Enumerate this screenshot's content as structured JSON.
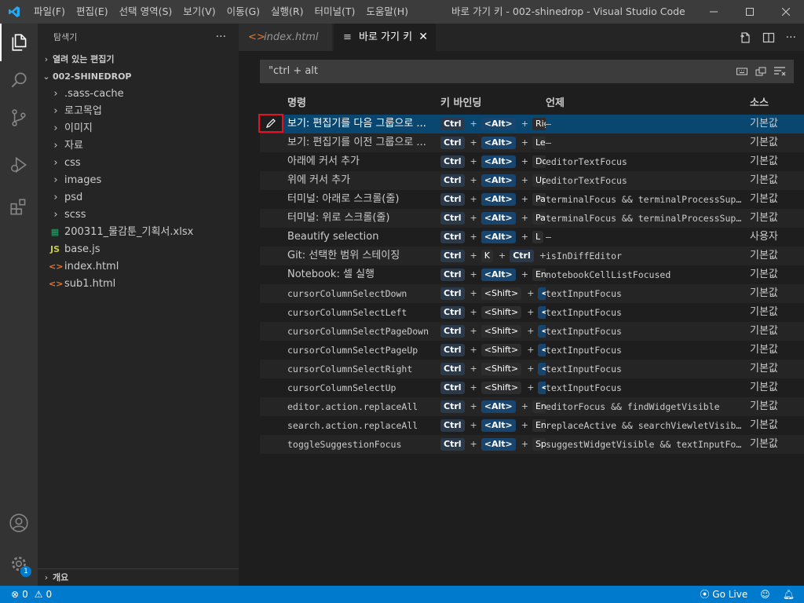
{
  "titlebar": {
    "menu": [
      "파일(F)",
      "편집(E)",
      "선택 영역(S)",
      "보기(V)",
      "이동(G)",
      "실행(R)",
      "터미널(T)",
      "도움말(H)"
    ],
    "window_title": "바로 가기 키 - 002-shinedrop - Visual Studio Code [관리..."
  },
  "sidebar": {
    "title": "탐색기",
    "more": "···",
    "open_editors": "열려 있는 편집기",
    "folder": "002-SHINEDROP",
    "items": [
      {
        "label": ".sass-cache",
        "kind": "folder"
      },
      {
        "label": "로고목업",
        "kind": "folder"
      },
      {
        "label": "이미지",
        "kind": "folder"
      },
      {
        "label": "자료",
        "kind": "folder"
      },
      {
        "label": "css",
        "kind": "folder"
      },
      {
        "label": "images",
        "kind": "folder"
      },
      {
        "label": "psd",
        "kind": "folder"
      },
      {
        "label": "scss",
        "kind": "folder"
      },
      {
        "label": "200311_물감툰_기획서.xlsx",
        "kind": "xlsx"
      },
      {
        "label": "base.js",
        "kind": "js"
      },
      {
        "label": "index.html",
        "kind": "html"
      },
      {
        "label": "sub1.html",
        "kind": "html"
      }
    ],
    "outline": "개요"
  },
  "activity": {
    "badge": "1"
  },
  "tabs": [
    {
      "label": "index.html",
      "active": false
    },
    {
      "label": "바로 가기 키",
      "active": true
    }
  ],
  "search": {
    "value": "\"ctrl + alt"
  },
  "table": {
    "headers": {
      "command": "명령",
      "keybinding": "키 바인딩",
      "when": "언제",
      "source": "소스"
    },
    "rows": [
      {
        "command": "보기: 편집기를 다음 그룹으로 ...",
        "mono": false,
        "keys": [
          "Ctrl",
          "<Alt>",
          "RightArrow"
        ],
        "when": "—",
        "source": "기본값"
      },
      {
        "command": "보기: 편집기를 이전 그룹으로 ...",
        "mono": false,
        "keys": [
          "Ctrl",
          "<Alt>",
          "LeftArrow"
        ],
        "when": "—",
        "source": "기본값"
      },
      {
        "command": "아래에 커서 추가",
        "mono": false,
        "keys": [
          "Ctrl",
          "<Alt>",
          "DownArrow"
        ],
        "when": "editorTextFocus",
        "source": "기본값"
      },
      {
        "command": "위에 커서 추가",
        "mono": false,
        "keys": [
          "Ctrl",
          "<Alt>",
          "UpArrow"
        ],
        "when": "editorTextFocus",
        "source": "기본값"
      },
      {
        "command": "터미널: 아래로 스크롤(줄)",
        "mono": false,
        "keys": [
          "Ctrl",
          "<Alt>",
          "PageDown"
        ],
        "when": "terminalFocus && terminalProcessSupported",
        "source": "기본값"
      },
      {
        "command": "터미널: 위로 스크롤(줄)",
        "mono": false,
        "keys": [
          "Ctrl",
          "<Alt>",
          "PageUp"
        ],
        "when": "terminalFocus && terminalProcessSupported",
        "source": "기본값"
      },
      {
        "command": "Beautify selection",
        "mono": false,
        "keys": [
          "Ctrl",
          "<Alt>",
          "L"
        ],
        "when": "—",
        "source": "사용자"
      },
      {
        "command": "Git: 선택한 범위 스테이징",
        "mono": false,
        "keys": [
          "Ctrl",
          "K",
          "Ctrl",
          "</"
        ],
        "when": "isInDiffEditor",
        "source": "기본값"
      },
      {
        "command": "Notebook: 셀 실행",
        "mono": false,
        "keys": [
          "Ctrl",
          "<Alt>",
          "Enter"
        ],
        "when": "notebookCellListFocused",
        "source": "기본값"
      },
      {
        "command": "cursorColumnSelectDown",
        "mono": true,
        "keys": [
          "Ctrl",
          "<Shift>",
          "<Alt>"
        ],
        "when": "textInputFocus",
        "source": "기본값"
      },
      {
        "command": "cursorColumnSelectLeft",
        "mono": true,
        "keys": [
          "Ctrl",
          "<Shift>",
          "<Alt>"
        ],
        "when": "textInputFocus",
        "source": "기본값"
      },
      {
        "command": "cursorColumnSelectPageDown",
        "mono": true,
        "keys": [
          "Ctrl",
          "<Shift>",
          "<Alt>"
        ],
        "when": "textInputFocus",
        "source": "기본값"
      },
      {
        "command": "cursorColumnSelectPageUp",
        "mono": true,
        "keys": [
          "Ctrl",
          "<Shift>",
          "<Alt>"
        ],
        "when": "textInputFocus",
        "source": "기본값"
      },
      {
        "command": "cursorColumnSelectRight",
        "mono": true,
        "keys": [
          "Ctrl",
          "<Shift>",
          "<Alt>"
        ],
        "when": "textInputFocus",
        "source": "기본값"
      },
      {
        "command": "cursorColumnSelectUp",
        "mono": true,
        "keys": [
          "Ctrl",
          "<Shift>",
          "<Alt>"
        ],
        "when": "textInputFocus",
        "source": "기본값"
      },
      {
        "command": "editor.action.replaceAll",
        "mono": true,
        "keys": [
          "Ctrl",
          "<Alt>",
          "Enter"
        ],
        "when": "editorFocus && findWidgetVisible",
        "source": "기본값"
      },
      {
        "command": "search.action.replaceAll",
        "mono": true,
        "keys": [
          "Ctrl",
          "<Alt>",
          "Enter"
        ],
        "when": "replaceActive && searchViewletVisible && searchInputBoxFocus",
        "source": "기본값"
      },
      {
        "command": "toggleSuggestionFocus",
        "mono": true,
        "keys": [
          "Ctrl",
          "<Alt>",
          "Space"
        ],
        "when": "suggestWidgetVisible && textInputFocus",
        "source": "기본값"
      }
    ]
  },
  "statusbar": {
    "errors": "0",
    "warnings": "0",
    "golive": "Go Live"
  },
  "colors": {
    "accent": "#007acc",
    "selection": "#094771",
    "highlight": "#e81123"
  }
}
